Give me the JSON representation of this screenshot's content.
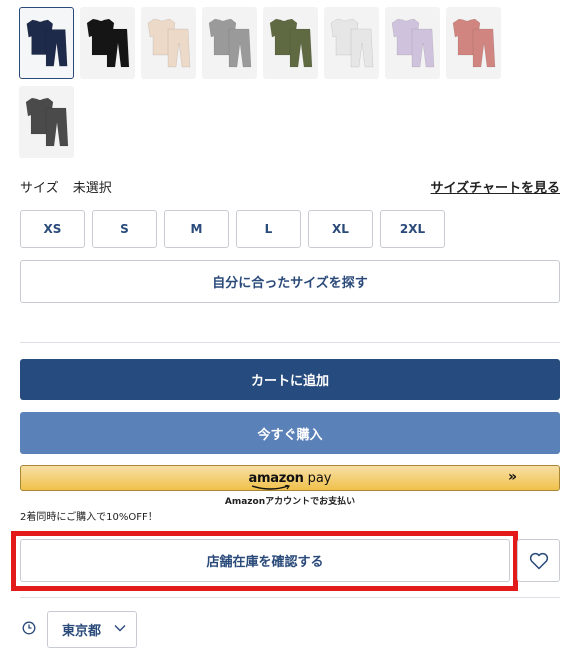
{
  "swatches": [
    {
      "name": "navy",
      "color": "#1e2a4a",
      "selected": true
    },
    {
      "name": "black",
      "color": "#151515",
      "selected": false
    },
    {
      "name": "beige",
      "color": "#ecd9c7",
      "selected": false
    },
    {
      "name": "gray",
      "color": "#9a9a9a",
      "selected": false
    },
    {
      "name": "olive",
      "color": "#5f6a43",
      "selected": false
    },
    {
      "name": "white",
      "color": "#e6e6e6",
      "selected": false
    },
    {
      "name": "lavender",
      "color": "#cfc2dd",
      "selected": false
    },
    {
      "name": "pink",
      "color": "#d08580",
      "selected": false
    },
    {
      "name": "charcoal",
      "color": "#4a4a4a",
      "selected": false
    }
  ],
  "size": {
    "label": "サイズ",
    "value": "未選択",
    "chart_link": "サイズチャートを見る",
    "options": [
      "XS",
      "S",
      "M",
      "L",
      "XL",
      "2XL"
    ]
  },
  "find_size_label": "自分に合ったサイズを探す",
  "cart_label": "カートに追加",
  "buy_now_label": "今すぐ購入",
  "amazon": {
    "logo_text": "amazon",
    "pay_text": "pay",
    "arrow": "»",
    "caption": "Amazonアカウントでお支払い"
  },
  "promo_text": "2着同時にご購入で10%OFF！",
  "store_stock_label": "店舗在庫を確認する",
  "prefecture": {
    "value": "東京都"
  },
  "colors": {
    "primary": "#264b7e",
    "secondary": "#5b82b8",
    "highlight": "#e21a1a"
  }
}
